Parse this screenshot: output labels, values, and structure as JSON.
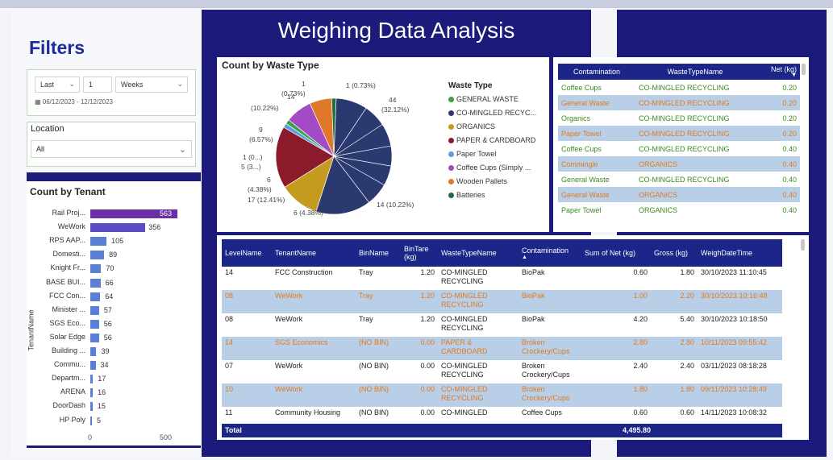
{
  "title": "Weighing Data Analysis",
  "filters": {
    "title": "Filters",
    "relative": {
      "mode": "Last",
      "count": "1",
      "unit": "Weeks"
    },
    "date_range": "06/12/2023 - 12/12/2023",
    "location_label": "Location",
    "location_value": "All"
  },
  "tenant_chart": {
    "title": "Count by Tenant",
    "axis_label": "TenantName",
    "chart_data": {
      "type": "bar",
      "categories": [
        "Rail Proj...",
        "WeWork",
        "RPS AAP...",
        "Domesti...",
        "Knight Fr...",
        "BASE BUI...",
        "FCC Con...",
        "Minister ...",
        "SGS Eco...",
        "Solar Edge",
        "Building ...",
        "Commu...",
        "Departm...",
        "ARENA",
        "DoorDash",
        "HP Poly"
      ],
      "values": [
        563,
        356,
        105,
        89,
        70,
        66,
        64,
        57,
        56,
        56,
        39,
        34,
        17,
        16,
        15,
        5
      ],
      "ticks": [
        "0",
        "500"
      ],
      "xlim": [
        0,
        563
      ]
    },
    "colors": {
      "top": "#6a2fa4",
      "second": "#5a4cc2",
      "rest": "#5b7fd4"
    }
  },
  "pie_chart": {
    "title": "Count by Waste Type",
    "legend_title": "Waste Type",
    "chart_data": {
      "type": "pie",
      "series": [
        {
          "name": "CO-MINGLED RECYC...",
          "value": 44,
          "label": "44\n(32.12%)",
          "color": "#2b3a6e"
        },
        {
          "name": "ORGANICS",
          "value": 9,
          "label": "9\n(6.57%)",
          "color": "#c49b1f"
        },
        {
          "name": "PAPER & CARDBOARD",
          "value": 14,
          "label": "14\n(10.22%)",
          "color": "#8b1b2a"
        },
        {
          "name": "Paper Towel",
          "value": 1,
          "label": "1\n(0.73%)",
          "color": "#5aa0d8"
        },
        {
          "name": "GENERAL WASTE",
          "value": 1,
          "label": "1 (0.73%)",
          "color": "#3aa04a"
        },
        {
          "name": "Coffee Cups (Simply ...",
          "value": 6,
          "label": "6\n(4.38%)",
          "color": "#a34bc4"
        },
        {
          "name": "Wooden Pallets",
          "value": 5,
          "label": "5 (3...)",
          "color": "#e0782a"
        },
        {
          "name": "Batteries",
          "value": 1,
          "label": "1 (0...)",
          "color": "#1e6e3c"
        }
      ],
      "extra_labels": [
        "14 (10.22%)",
        "17 (12.41%)",
        "6 (4.38%)"
      ]
    },
    "legend": [
      {
        "name": "GENERAL WASTE",
        "color": "#3aa04a"
      },
      {
        "name": "CO-MINGLED RECYC...",
        "color": "#2b3a6e"
      },
      {
        "name": "ORGANICS",
        "color": "#c49b1f"
      },
      {
        "name": "PAPER & CARDBOARD",
        "color": "#8b1b2a"
      },
      {
        "name": "Paper Towel",
        "color": "#5aa0d8"
      },
      {
        "name": "Coffee Cups (Simply ...",
        "color": "#a34bc4"
      },
      {
        "name": "Wooden Pallets",
        "color": "#e0782a"
      },
      {
        "name": "Batteries",
        "color": "#1e6e3c"
      }
    ]
  },
  "contamination_table": {
    "headers": [
      "Contamination",
      "WasteTypeName",
      "Net (kg)"
    ],
    "rows": [
      [
        "Coffee Cups",
        "CO-MINGLED RECYCLING",
        "0.20"
      ],
      [
        "General Waste",
        "CO-MINGLED RECYCLING",
        "0.20"
      ],
      [
        "Organics",
        "CO-MINGLED RECYCLING",
        "0.20"
      ],
      [
        "Paper Towel",
        "CO-MINGLED RECYCLING",
        "0.20"
      ],
      [
        "Coffee Cups",
        "CO-MINGLED RECYCLING",
        "0.40"
      ],
      [
        "Commingle",
        "ORGANICS",
        "0.40"
      ],
      [
        "General Waste",
        "CO-MINGLED RECYCLING",
        "0.40"
      ],
      [
        "General Waste",
        "ORGANICS",
        "0.40"
      ],
      [
        "Paper Towel",
        "ORGANICS",
        "0.40"
      ]
    ]
  },
  "detail_table": {
    "headers": [
      "LevelName",
      "TenantName",
      "BinName",
      "BinTare (kg)",
      "WasteTypeName",
      "Contamination",
      "Sum of Net (kg)",
      "Gross (kg)",
      "WeighDateTime"
    ],
    "rows": [
      [
        "14",
        "FCC Construction",
        "Tray",
        "1.20",
        "CO-MINGLED RECYCLING",
        "BioPak",
        "0.60",
        "1.80",
        "30/10/2023 11:10:45"
      ],
      [
        "08",
        "WeWork",
        "Tray",
        "1.20",
        "CO-MINGLED RECYCLING",
        "BioPak",
        "1.00",
        "2.20",
        "30/10/2023 10:16:48"
      ],
      [
        "08",
        "WeWork",
        "Tray",
        "1.20",
        "CO-MINGLED RECYCLING",
        "BioPak",
        "4.20",
        "5.40",
        "30/10/2023 10:18:50"
      ],
      [
        "14",
        "SGS Economics",
        "(NO BIN)",
        "0.00",
        "PAPER & CARDBOARD",
        "Broken Crockery/Cups",
        "2.80",
        "2.80",
        "10/11/2023 09:55:42"
      ],
      [
        "07",
        "WeWork",
        "(NO BIN)",
        "0.00",
        "CO-MINGLED RECYCLING",
        "Broken Crockery/Cups",
        "2.40",
        "2.40",
        "03/11/2023 08:18:28"
      ],
      [
        "10",
        "WeWork",
        "(NO BIN)",
        "0.00",
        "CO-MINGLED RECYCLING",
        "Broken Crockery/Cups",
        "1.80",
        "1.80",
        "09/11/2023 10:28:49"
      ],
      [
        "11",
        "Community Housing",
        "(NO BIN)",
        "0.00",
        "CO-MINGLED",
        "Coffee Cups",
        "0.60",
        "0.60",
        "14/11/2023 10:08:32"
      ]
    ],
    "total_label": "Total",
    "total_value": "4,495.80"
  }
}
